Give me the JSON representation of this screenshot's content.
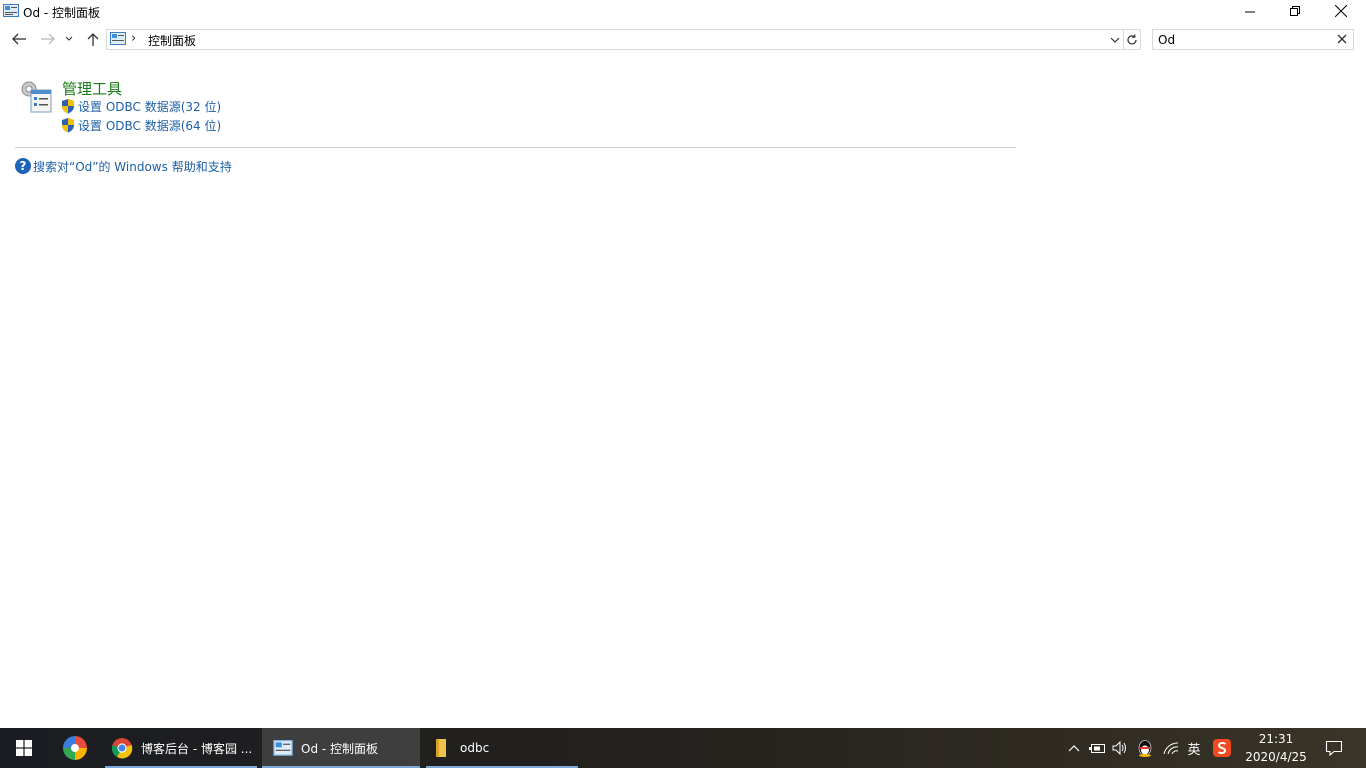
{
  "window": {
    "title": "Od - 控制面板"
  },
  "address": {
    "crumb": "控制面板"
  },
  "search": {
    "value": "Od"
  },
  "results": {
    "group_title": "管理工具",
    "links": [
      "设置 ODBC 数据源(32 位)",
      "设置 ODBC 数据源(64 位)"
    ],
    "help_link": "搜索对“Od”的 Windows 帮助和支持"
  },
  "taskbar": {
    "tasks": [
      {
        "label": "博客后台 - 博客园 ..."
      },
      {
        "label": "Od - 控制面板"
      },
      {
        "label": "odbc"
      }
    ],
    "tray": {
      "ime": "英"
    },
    "clock": {
      "time": "21:31",
      "date": "2020/4/25"
    }
  },
  "colors": {
    "group_title": "#1a7c17",
    "link": "#1e5fa8",
    "taskbar": "#1f1f22"
  }
}
